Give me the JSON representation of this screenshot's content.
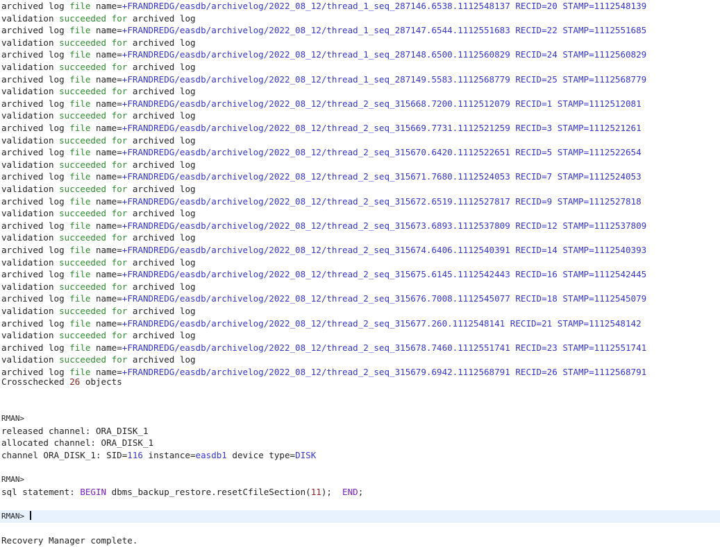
{
  "archived_logs": [
    {
      "path": "+FRANDREDG/easdb/archivelog/2022_08_12/thread_1_seq_287146.6538.1112548137",
      "recid": "20",
      "stamp": "1112548139"
    },
    {
      "path": "+FRANDREDG/easdb/archivelog/2022_08_12/thread_1_seq_287147.6544.1112551683",
      "recid": "22",
      "stamp": "1112551685"
    },
    {
      "path": "+FRANDREDG/easdb/archivelog/2022_08_12/thread_1_seq_287148.6500.1112560829",
      "recid": "24",
      "stamp": "1112560829"
    },
    {
      "path": "+FRANDREDG/easdb/archivelog/2022_08_12/thread_1_seq_287149.5583.1112568779",
      "recid": "25",
      "stamp": "1112568779"
    },
    {
      "path": "+FRANDREDG/easdb/archivelog/2022_08_12/thread_2_seq_315668.7200.1112512079",
      "recid": "1",
      "stamp": "1112512081"
    },
    {
      "path": "+FRANDREDG/easdb/archivelog/2022_08_12/thread_2_seq_315669.7731.1112521259",
      "recid": "3",
      "stamp": "1112521261"
    },
    {
      "path": "+FRANDREDG/easdb/archivelog/2022_08_12/thread_2_seq_315670.6420.1112522651",
      "recid": "5",
      "stamp": "1112522654"
    },
    {
      "path": "+FRANDREDG/easdb/archivelog/2022_08_12/thread_2_seq_315671.7680.1112524053",
      "recid": "7",
      "stamp": "1112524053"
    },
    {
      "path": "+FRANDREDG/easdb/archivelog/2022_08_12/thread_2_seq_315672.6519.1112527817",
      "recid": "9",
      "stamp": "1112527818"
    },
    {
      "path": "+FRANDREDG/easdb/archivelog/2022_08_12/thread_2_seq_315673.6893.1112537809",
      "recid": "12",
      "stamp": "1112537809"
    },
    {
      "path": "+FRANDREDG/easdb/archivelog/2022_08_12/thread_2_seq_315674.6406.1112540391",
      "recid": "14",
      "stamp": "1112540393"
    },
    {
      "path": "+FRANDREDG/easdb/archivelog/2022_08_12/thread_2_seq_315675.6145.1112542443",
      "recid": "16",
      "stamp": "1112542445"
    },
    {
      "path": "+FRANDREDG/easdb/archivelog/2022_08_12/thread_2_seq_315676.7008.1112545077",
      "recid": "18",
      "stamp": "1112545079"
    },
    {
      "path": "+FRANDREDG/easdb/archivelog/2022_08_12/thread_2_seq_315677.260.1112548141",
      "recid": "21",
      "stamp": "1112548142"
    },
    {
      "path": "+FRANDREDG/easdb/archivelog/2022_08_12/thread_2_seq_315678.7460.1112551741",
      "recid": "23",
      "stamp": "1112551741"
    },
    {
      "path": "+FRANDREDG/easdb/archivelog/2022_08_12/thread_2_seq_315679.6942.1112568791",
      "recid": "26",
      "stamp": "1112568791"
    }
  ],
  "tokens": {
    "archived_log": "archived log",
    "file": "file",
    "name_eq": "name=",
    "recid": "RECID=",
    "stamp": "STAMP=",
    "validation": "validation",
    "succeeded": "succeeded",
    "for_word": "for",
    "archived_log_end": "archived log"
  },
  "crosscheck": {
    "prefix": "Crosschecked",
    "count": "26",
    "suffix": "objects"
  },
  "rman_prompt": "RMAN>",
  "channel": {
    "released": "released channel: ORA_DISK_1",
    "allocated": "allocated channel: ORA_DISK_1",
    "info_prefix": "channel ORA_DISK_1: SID=",
    "sid": "116",
    "instance_label": "instance=",
    "instance": "easdb1",
    "device_label": "device type=",
    "device": "DISK"
  },
  "sql": {
    "prefix": "sql statement:",
    "begin": "BEGIN",
    "call": "dbms_backup_restore.resetCfileSection(",
    "arg": "11",
    "close": ");",
    "end": "END",
    "end_semicolon": ";"
  },
  "complete": "Recovery Manager complete.",
  "colors": {
    "green": "#2e8b2e",
    "blue": "#3535c9",
    "purple": "#7a1dc0",
    "darkred": "#8b1a1a",
    "current_line": "#e8f2fe"
  }
}
